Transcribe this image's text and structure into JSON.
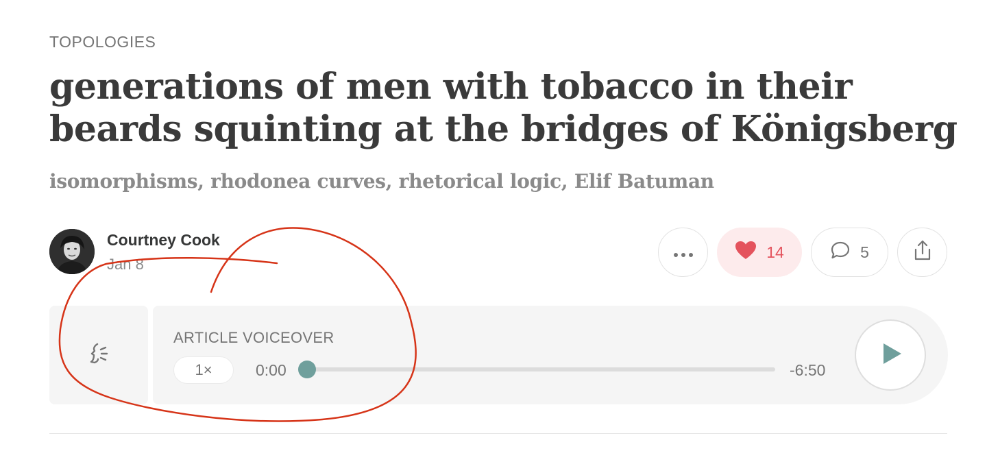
{
  "post": {
    "section": "TOPOLOGIES",
    "title": "generations of men with tobacco in their beards squinting at the bridges of Königsberg",
    "subtitle": "isomorphisms, rhodonea curves, rhetorical logic, Elif Batuman"
  },
  "byline": {
    "author": "Courtney Cook",
    "date": "Jan 8"
  },
  "actions": {
    "more_icon": "ellipsis-icon",
    "like_icon": "heart-icon",
    "like_count": "14",
    "comment_icon": "speech-bubble-icon",
    "comment_count": "5",
    "share_icon": "share-icon"
  },
  "voiceover": {
    "icon": "speaking-head-icon",
    "label": "ARTICLE VOICEOVER",
    "speed": "1×",
    "elapsed": "0:00",
    "remaining": "-6:50",
    "progress": 0,
    "play_icon": "play-icon"
  },
  "colors": {
    "accent": "#6f9f9c",
    "like": "#e4535d",
    "annotation": "#d63418"
  }
}
